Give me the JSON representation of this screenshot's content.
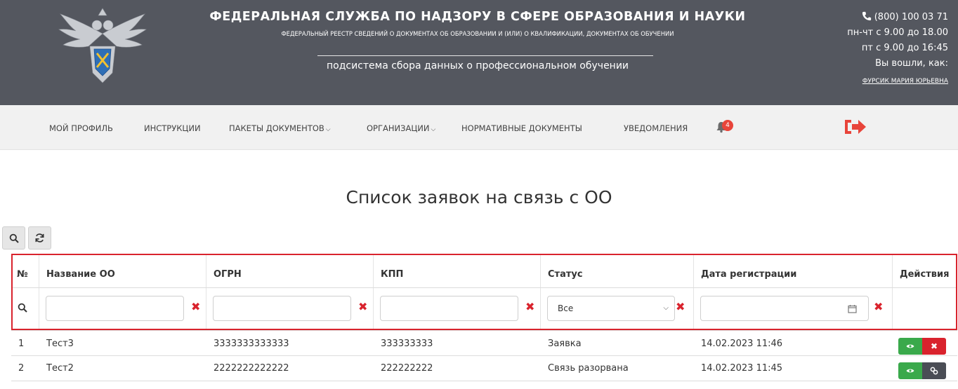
{
  "header": {
    "title": "ФЕДЕРАЛЬНАЯ СЛУЖБА ПО НАДЗОРУ В СФЕРЕ ОБРАЗОВАНИЯ И НАУКИ",
    "subtitle": "ФЕДЕРАЛЬНЫЙ РЕЕСТР СВЕДЕНИЙ О ДОКУМЕНТАХ ОБ ОБРАЗОВАНИИ И (ИЛИ) О КВАЛИФИКАЦИИ, ДОКУМЕНТАХ ОБ ОБУЧЕНИИ",
    "subsystem": "подсистема сбора данных о профессиональном обучении",
    "phone": "(800) 100 03 71",
    "hours1": "пн-чт с 9.00 до 18.00",
    "hours2": "пт с 9.00 до 16:45",
    "logged_in": "Вы вошли, как:",
    "user": "ФУРСИК МАРИЯ ЮРЬЕВНА"
  },
  "nav": {
    "profile": "МОЙ ПРОФИЛЬ",
    "instructions": "ИНСТРУКЦИИ",
    "packages": "ПАКЕТЫ ДОКУМЕНТОВ",
    "organizations": "ОРГАНИЗАЦИИ",
    "normative": "НОРМАТИВНЫЕ ДОКУМЕНТЫ",
    "notifications": "УВЕДОМЛЕНИЯ",
    "notifications_count": "4"
  },
  "page": {
    "title": "Список заявок на связь с ОО"
  },
  "table": {
    "headers": {
      "num": "№",
      "name": "Название ОО",
      "ogrn": "ОГРН",
      "kpp": "КПП",
      "status": "Статус",
      "date": "Дата регистрации",
      "actions": "Действия"
    },
    "filters": {
      "status_selected": "Все"
    },
    "rows": [
      {
        "num": "1",
        "name": "Тест3",
        "ogrn": "3333333333333",
        "kpp": "333333333",
        "status": "Заявка",
        "date": "14.02.2023 11:46"
      },
      {
        "num": "2",
        "name": "Тест2",
        "ogrn": "2222222222222",
        "kpp": "222222222",
        "status": "Связь разорвана",
        "date": "14.02.2023 11:45"
      }
    ]
  },
  "colors": {
    "header_bg": "#54575f",
    "accent_red": "#d9232d",
    "view_green": "#3aa94b",
    "delete_red": "#d9232d",
    "link_dark": "#4a4d55"
  }
}
